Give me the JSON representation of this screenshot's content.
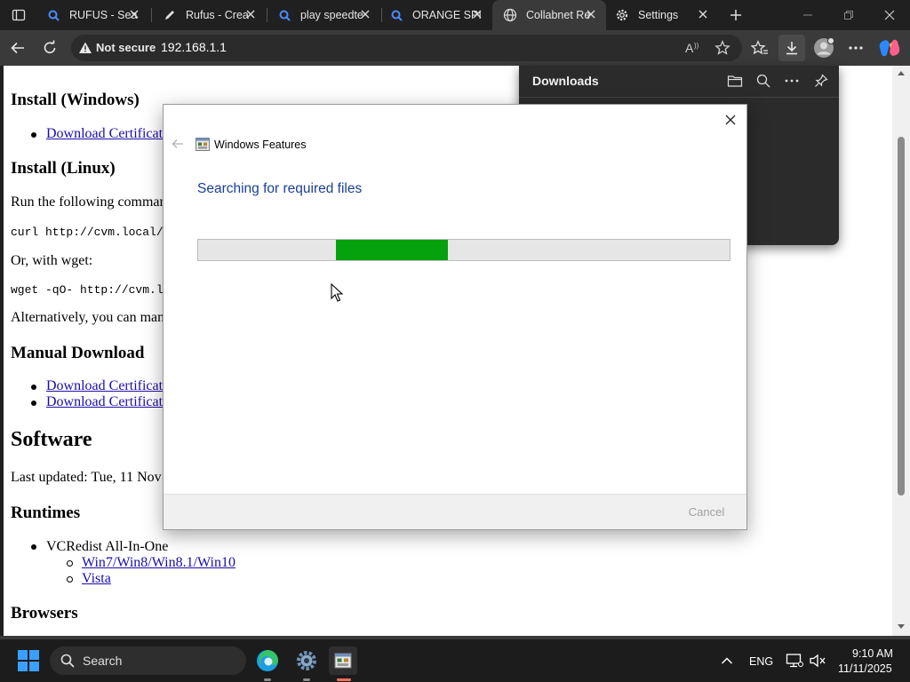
{
  "tabs": [
    {
      "label": "RUFUS - Sea",
      "icon": "search-icon"
    },
    {
      "label": "Rufus - Crea",
      "icon": "pen-icon"
    },
    {
      "label": "play speedte",
      "icon": "search-icon"
    },
    {
      "label": "ORANGE SPI",
      "icon": "search-icon"
    },
    {
      "label": "Collabnet Re",
      "icon": "globe-icon"
    },
    {
      "label": "Settings",
      "icon": "gear-icon"
    }
  ],
  "address_bar": {
    "security_label": "Not secure",
    "url": "192.168.1.1"
  },
  "page": {
    "h_install_windows": "Install (Windows)",
    "link_windows_cert": "Download Certificat",
    "h_install_linux": "Install (Linux)",
    "run_following": "Run the following comman",
    "curl_cmd": "curl http://cvm.local/l",
    "or_wget": "Or, with wget:",
    "wget_cmd": "wget -qO- http://cvm.loc",
    "alternatively": "Alternatively, you can man",
    "h_manual_download": "Manual Download",
    "link_manual_1": "Download Certificat",
    "link_manual_2": "Download Certificat",
    "h_software": "Software",
    "last_updated": "Last updated: Tue, 11 Nov",
    "h_runtimes": "Runtimes",
    "vcredist": "VCRedist All-In-One",
    "link_win7": "Win7/Win8/Win8.1/Win10",
    "link_vista": "Vista",
    "h_browsers": "Browsers"
  },
  "downloads_panel": {
    "title": "Downloads"
  },
  "dialog": {
    "title": "Windows Features",
    "heading": "Searching for required files",
    "cancel_label": "Cancel",
    "cancel_enabled": false,
    "progress_fill_start": 0.26,
    "progress_fill_end": 0.47,
    "progress_color": "#06a20e"
  },
  "taskbar": {
    "search_label": "Search",
    "language": "ENG",
    "time": "9:10 AM",
    "date": "11/11/2025"
  }
}
